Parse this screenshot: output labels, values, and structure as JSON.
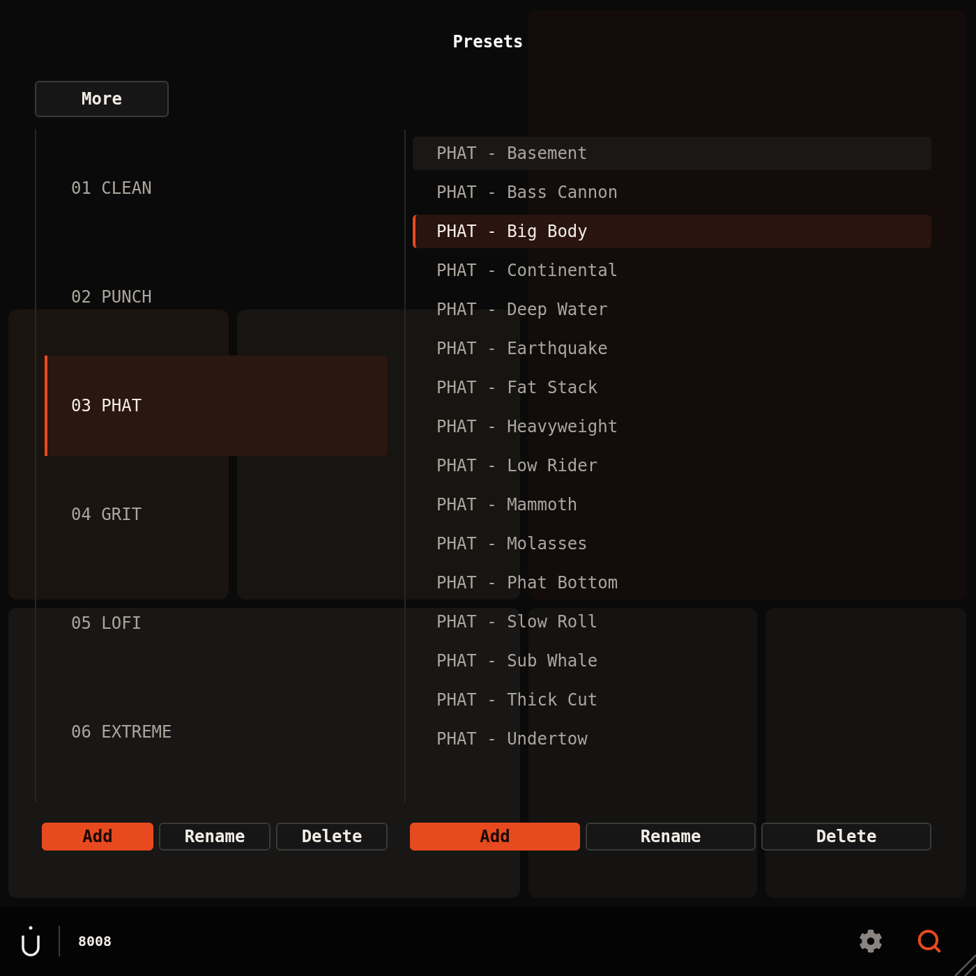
{
  "title": "Presets",
  "more_button": "More",
  "banks": [
    {
      "label": "01 CLEAN",
      "selected": false
    },
    {
      "label": "02 PUNCH",
      "selected": false
    },
    {
      "label": "03 PHAT",
      "selected": true
    },
    {
      "label": "04 GRIT",
      "selected": false
    },
    {
      "label": "05 LOFI",
      "selected": false
    },
    {
      "label": "06 EXTREME",
      "selected": false
    }
  ],
  "presets": [
    {
      "label": "PHAT - Basement",
      "selected": false,
      "hovered": true
    },
    {
      "label": "PHAT - Bass Cannon",
      "selected": false,
      "hovered": false
    },
    {
      "label": "PHAT - Big Body",
      "selected": true,
      "hovered": false
    },
    {
      "label": "PHAT - Continental",
      "selected": false,
      "hovered": false
    },
    {
      "label": "PHAT - Deep Water",
      "selected": false,
      "hovered": false
    },
    {
      "label": "PHAT - Earthquake",
      "selected": false,
      "hovered": false
    },
    {
      "label": "PHAT - Fat Stack",
      "selected": false,
      "hovered": false
    },
    {
      "label": "PHAT - Heavyweight",
      "selected": false,
      "hovered": false
    },
    {
      "label": "PHAT - Low Rider",
      "selected": false,
      "hovered": false
    },
    {
      "label": "PHAT - Mammoth",
      "selected": false,
      "hovered": false
    },
    {
      "label": "PHAT - Molasses",
      "selected": false,
      "hovered": false
    },
    {
      "label": "PHAT - Phat Bottom",
      "selected": false,
      "hovered": false
    },
    {
      "label": "PHAT - Slow Roll",
      "selected": false,
      "hovered": false
    },
    {
      "label": "PHAT - Sub Whale",
      "selected": false,
      "hovered": false
    },
    {
      "label": "PHAT - Thick Cut",
      "selected": false,
      "hovered": false
    },
    {
      "label": "PHAT - Undertow",
      "selected": false,
      "hovered": false
    }
  ],
  "bank_actions": [
    {
      "label": "Add",
      "kind": "primary"
    },
    {
      "label": "Rename",
      "kind": "secondary"
    },
    {
      "label": "Delete",
      "kind": "secondary"
    }
  ],
  "preset_actions": [
    {
      "label": "Add",
      "kind": "primary"
    },
    {
      "label": "Rename",
      "kind": "secondary"
    },
    {
      "label": "Delete",
      "kind": "secondary"
    }
  ],
  "footer": {
    "product": "8008"
  }
}
